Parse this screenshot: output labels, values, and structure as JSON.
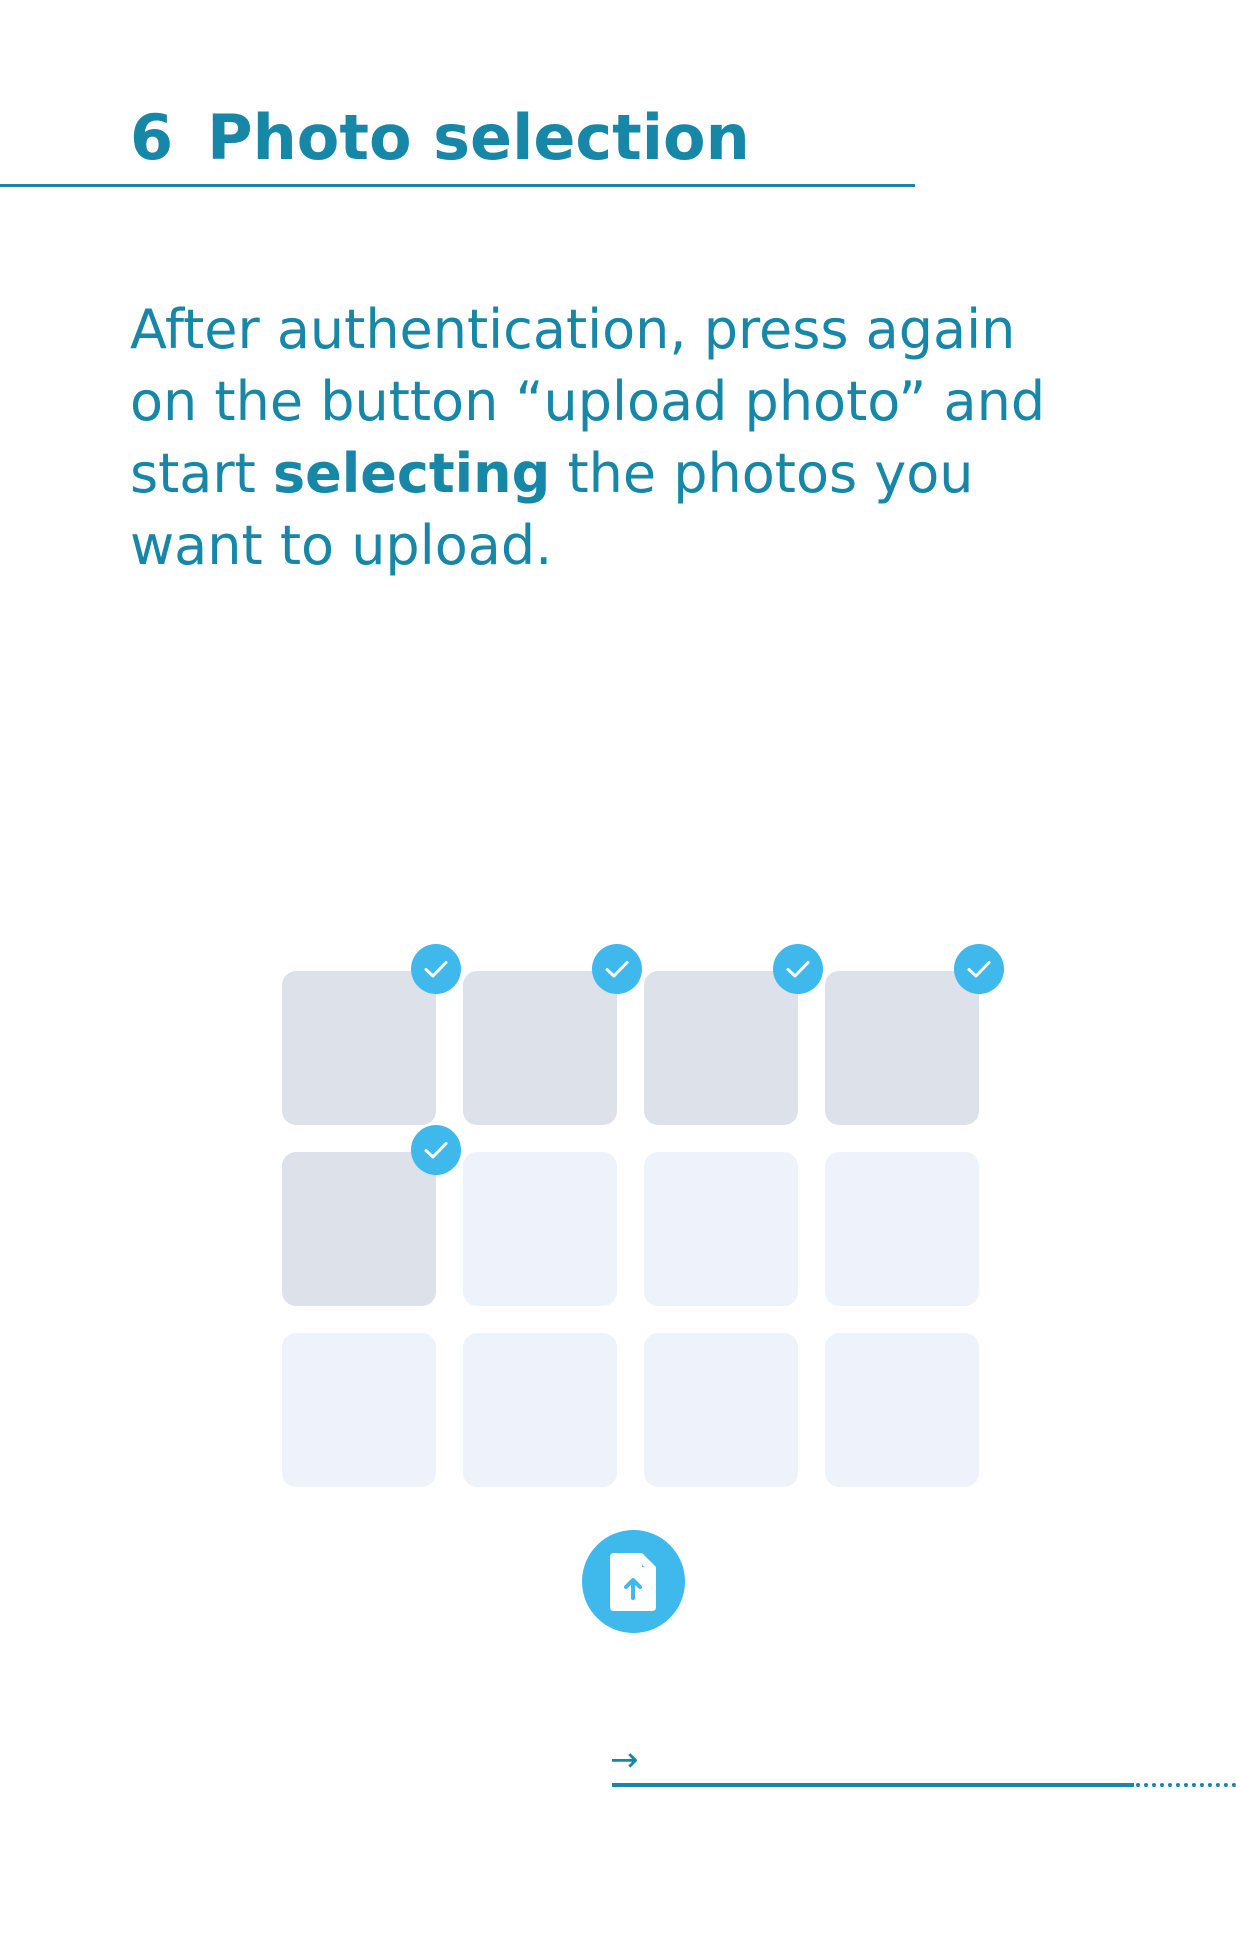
{
  "section": {
    "number": "6",
    "title": "Photo selection"
  },
  "intro": {
    "before": "After authentication, press again on the button “upload photo” and start ",
    "emphasis": "selecting",
    "after": " the photos you want to upload."
  },
  "photo_grid": {
    "rows": 3,
    "columns": 4,
    "tiles": [
      {
        "selected": true
      },
      {
        "selected": true
      },
      {
        "selected": true
      },
      {
        "selected": true
      },
      {
        "selected": true
      },
      {
        "selected": false
      },
      {
        "selected": false
      },
      {
        "selected": false
      },
      {
        "selected": false
      },
      {
        "selected": false
      },
      {
        "selected": false
      },
      {
        "selected": false
      }
    ]
  },
  "upload_button": {
    "icon": "file-upload-icon"
  },
  "navigation": {
    "next_arrow": "→"
  },
  "colors": {
    "accent": "#1787a8",
    "badge": "#3fb8ec",
    "selected_tile": "#dde1e9",
    "empty_tile": "#eef3fb"
  }
}
